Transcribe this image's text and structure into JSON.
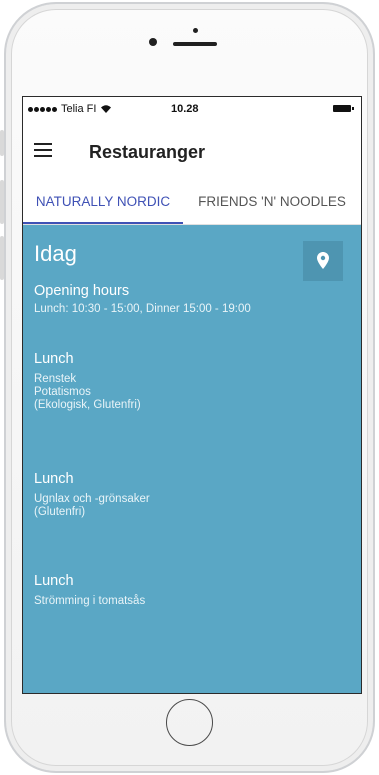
{
  "statusbar": {
    "carrier": "Telia FI",
    "time": "10.28",
    "signal_icon": "signal-dots-icon",
    "wifi_icon": "wifi-icon",
    "battery_icon": "battery-icon"
  },
  "appbar": {
    "title": "Restauranger",
    "menu_icon": "hamburger-menu-icon"
  },
  "tabs": [
    {
      "label": "NATURALLY NORDIC",
      "active": true
    },
    {
      "label": "FRIENDS 'N' NOODLES",
      "active": false
    }
  ],
  "content": {
    "day": "Idag",
    "map_icon": "location-pin-icon",
    "opening_hours": {
      "title": "Opening hours",
      "text": "Lunch: 10:30 - 15:00, Dinner 15:00 - 19:00"
    },
    "meals": [
      {
        "title": "Lunch",
        "lines": [
          "Renstek",
          "Potatismos",
          "(Ekologisk, Glutenfri)"
        ]
      },
      {
        "title": "Lunch",
        "lines": [
          "Ugnlax och -grönsaker",
          "(Glutenfri)"
        ]
      },
      {
        "title": "Lunch",
        "lines": [
          "Strömming i tomatsås"
        ]
      }
    ]
  },
  "colors": {
    "accent": "#3f51b5",
    "content_background": "#5aa7c5",
    "map_button": "#4e95b1"
  }
}
